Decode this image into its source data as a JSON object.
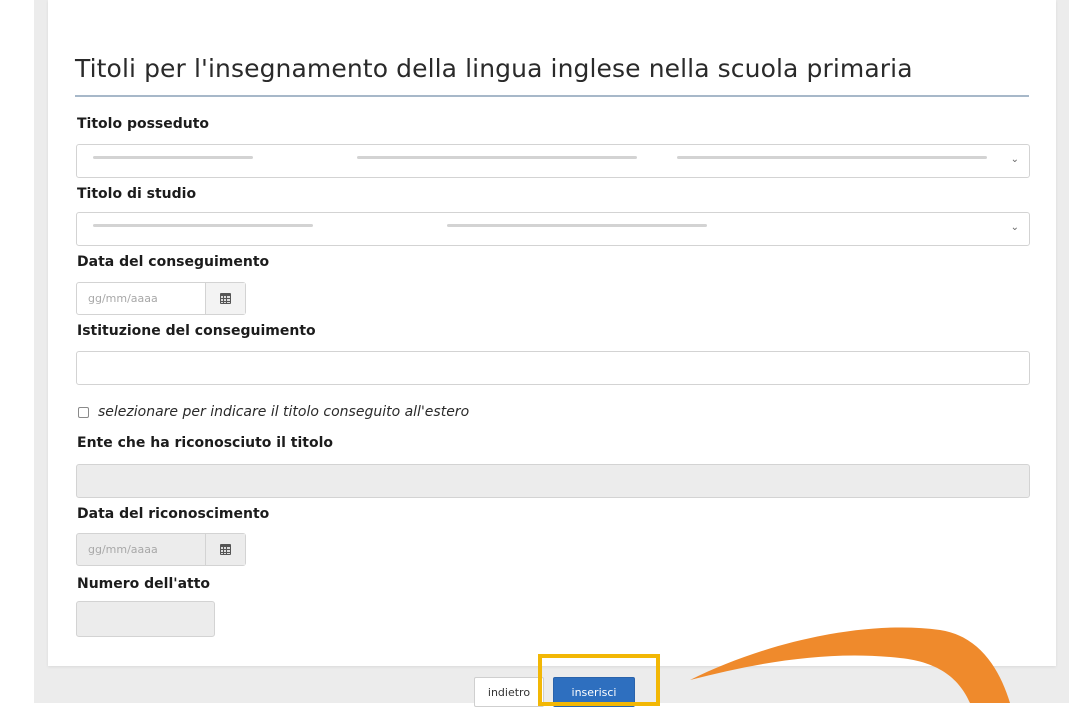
{
  "form": {
    "title": "Titoli per l'insegnamento della lingua inglese nella scuola primaria",
    "titolo_posseduto": {
      "label": "Titolo posseduto",
      "value": ""
    },
    "titolo_studio": {
      "label": "Titolo di studio",
      "value": ""
    },
    "data_conseguimento": {
      "label": "Data del conseguimento",
      "placeholder": "gg/mm/aaaa"
    },
    "istituzione": {
      "label": "Istituzione del conseguimento",
      "value": ""
    },
    "estero_checkbox": {
      "label": "selezionare per indicare il titolo conseguito all'estero",
      "checked": false
    },
    "ente": {
      "label": "Ente che ha riconosciuto il titolo",
      "value": ""
    },
    "data_riconoscimento": {
      "label": "Data del riconoscimento",
      "placeholder": "gg/mm/aaaa"
    },
    "numero_atto": {
      "label": "Numero dell'atto",
      "value": ""
    }
  },
  "buttons": {
    "back_label": "indietro",
    "insert_label": "inserisci"
  },
  "colors": {
    "primary": "#2e6fbf",
    "highlight": "#f2b705",
    "accent_orange": "#ef8a2c",
    "title_rule": "#a7b8c9",
    "disabled_bg": "#ececec"
  },
  "icons": {
    "select_arrow": "chevron-down-icon",
    "date_picker": "calendar-icon"
  }
}
